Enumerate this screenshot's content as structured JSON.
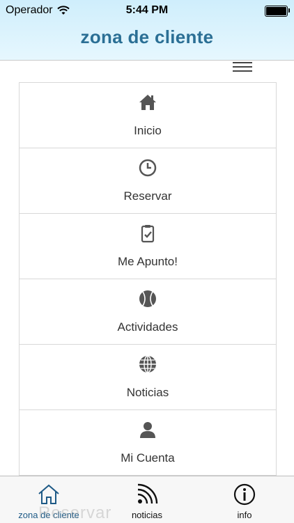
{
  "status_bar": {
    "carrier": "Operador",
    "time": "5:44 PM"
  },
  "header": {
    "title": "zona de cliente"
  },
  "menu": {
    "items": [
      {
        "label": "Inicio",
        "icon": "home-icon"
      },
      {
        "label": "Reservar",
        "icon": "clock-icon"
      },
      {
        "label": "Me Apunto!",
        "icon": "clipboard-check-icon"
      },
      {
        "label": "Actividades",
        "icon": "tennis-ball-icon"
      },
      {
        "label": "Noticias",
        "icon": "globe-icon"
      },
      {
        "label": "Mi Cuenta",
        "icon": "user-icon"
      }
    ]
  },
  "tabs": [
    {
      "label": "zona de cliente",
      "icon": "home-outline-icon",
      "active": true
    },
    {
      "label": "noticias",
      "icon": "rss-icon",
      "active": false
    },
    {
      "label": "info",
      "icon": "info-icon",
      "active": false
    }
  ],
  "ghost_text": "Reservar",
  "colors": {
    "header_title": "#2b6f95",
    "icon_dark": "#555555",
    "tab_active": "#1e5a86"
  }
}
